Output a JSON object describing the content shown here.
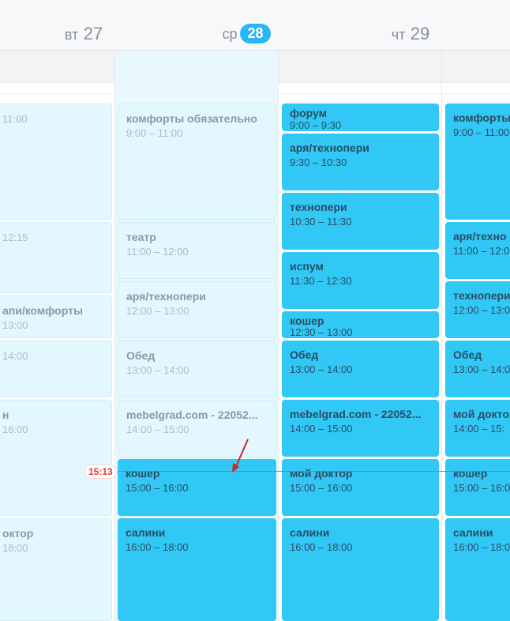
{
  "days": [
    {
      "dow": "вт",
      "num": "27"
    },
    {
      "dow": "ср",
      "num": "28"
    },
    {
      "dow": "чт",
      "num": "29"
    }
  ],
  "now_label": "15:13",
  "columns": {
    "tue": [
      {
        "title": "",
        "time": "11:00"
      },
      {
        "title": "",
        "time": "12:15"
      },
      {
        "title": "апи/комфорты",
        "time": "13:00"
      },
      {
        "title": "",
        "time": "14:00"
      },
      {
        "title": "н",
        "time": "16:00"
      },
      {
        "title": "октор",
        "time": "18:00"
      }
    ],
    "wed": [
      {
        "title": "комфорты обязательно",
        "time": "9:00 – 11:00"
      },
      {
        "title": "театр",
        "time": "11:00 – 12:00"
      },
      {
        "title": "аря/технопери",
        "time": "12:00 – 13:00"
      },
      {
        "title": "Обед",
        "time": "13:00 – 14:00"
      },
      {
        "title": "mebelgrad.com - 22052...",
        "time": "14:00 – 15:00"
      },
      {
        "title": "кошер",
        "time": "15:00 – 16:00"
      },
      {
        "title": "салини",
        "time": "16:00 – 18:00"
      }
    ],
    "thu": [
      {
        "title": "форум",
        "time": "9:00 – 9:30"
      },
      {
        "title": "аря/технопери",
        "time": "9:30 – 10:30"
      },
      {
        "title": "технопери",
        "time": "10:30 – 11:30"
      },
      {
        "title": "испум",
        "time": "11:30 – 12:30"
      },
      {
        "title": "кошер",
        "time": "12:30 – 13:00"
      },
      {
        "title": "Обед",
        "time": "13:00 – 14:00"
      },
      {
        "title": "mebelgrad.com - 22052...",
        "time": "14:00 – 15:00"
      },
      {
        "title": "мой доктор",
        "time": "15:00 – 16:00"
      },
      {
        "title": "салини",
        "time": "16:00 – 18:00"
      }
    ],
    "fri": [
      {
        "title": "комфорты",
        "time": "9:00 – 11:00"
      },
      {
        "title": "аря/техно",
        "time": "11:00 – 12:0"
      },
      {
        "title": "технопери",
        "time": "12:00 – 13:0"
      },
      {
        "title": "Обед",
        "time": "13:00 – 14:0"
      },
      {
        "title": "мой доктор",
        "time": "14:00 – 15:"
      },
      {
        "title": "кошер",
        "time": "15:00 – 16:0"
      },
      {
        "title": "салини",
        "time": "16:00 – 18:0"
      }
    ]
  },
  "colors": {
    "accent": "#29b6f6",
    "event": "#31c8f5",
    "past_event": "#e2f7fe",
    "now_line": "#ef5350"
  }
}
